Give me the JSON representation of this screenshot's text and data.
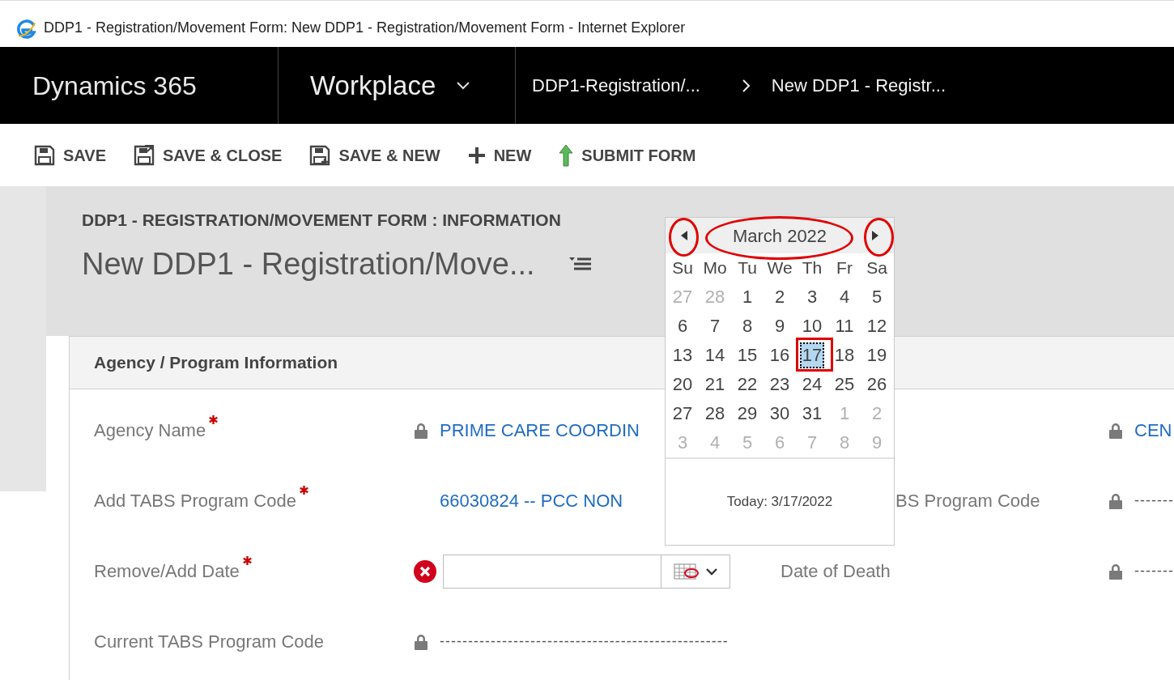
{
  "window": {
    "title": "DDP1 - Registration/Movement Form: New DDP1 - Registration/Movement Form - Internet Explorer"
  },
  "nav": {
    "app": "Dynamics 365",
    "area": "Workplace",
    "breadcrumbs": [
      "DDP1-Registration/...",
      "New DDP1 - Registr..."
    ]
  },
  "commands": [
    {
      "label": "SAVE",
      "kind": "save"
    },
    {
      "label": "SAVE & CLOSE",
      "kind": "save-close"
    },
    {
      "label": "SAVE & NEW",
      "kind": "save-new"
    },
    {
      "label": "NEW",
      "kind": "new"
    },
    {
      "label": "SUBMIT FORM",
      "kind": "submit"
    }
  ],
  "header": {
    "entity": "DDP1 - REGISTRATION/MOVEMENT FORM : INFORMATION",
    "title": "New DDP1 - Registration/Move..."
  },
  "section": {
    "title": "Agency / Program Information",
    "rows": [
      {
        "label": "Agency Name",
        "required": true,
        "value": {
          "kind": "locked-link",
          "text": "PRIME CARE COORDIN"
        },
        "right": {
          "value": {
            "kind": "locked-link",
            "text": "CEN"
          }
        }
      },
      {
        "label": "Add TABS Program Code",
        "required": true,
        "value": {
          "kind": "link",
          "text": "66030824 -- PCC NON"
        },
        "right": {
          "label": "BS Program Code",
          "value": {
            "kind": "locked",
            "text": "-------"
          }
        }
      },
      {
        "label": "Remove/Add Date",
        "required": true,
        "value": {
          "kind": "date",
          "error": true
        },
        "right": {
          "label": "Date of Death",
          "value": {
            "kind": "locked",
            "text": "-------"
          }
        }
      },
      {
        "label": "Current TABS Program Code",
        "required": false,
        "value": {
          "kind": "locked",
          "text": "---------------------------------------------------"
        }
      }
    ]
  },
  "calendar": {
    "month": "March 2022",
    "weekdays": [
      "Su",
      "Mo",
      "Tu",
      "We",
      "Th",
      "Fr",
      "Sa"
    ],
    "weeks": [
      [
        {
          "day": "27",
          "muted": true,
          "selected": false
        },
        {
          "day": "28",
          "muted": true,
          "selected": false
        },
        {
          "day": "1",
          "muted": false,
          "selected": false
        },
        {
          "day": "2",
          "muted": false,
          "selected": false
        },
        {
          "day": "3",
          "muted": false,
          "selected": false
        },
        {
          "day": "4",
          "muted": false,
          "selected": false
        },
        {
          "day": "5",
          "muted": false,
          "selected": false
        }
      ],
      [
        {
          "day": "6",
          "muted": false,
          "selected": false
        },
        {
          "day": "7",
          "muted": false,
          "selected": false
        },
        {
          "day": "8",
          "muted": false,
          "selected": false
        },
        {
          "day": "9",
          "muted": false,
          "selected": false
        },
        {
          "day": "10",
          "muted": false,
          "selected": false
        },
        {
          "day": "11",
          "muted": false,
          "selected": false
        },
        {
          "day": "12",
          "muted": false,
          "selected": false
        }
      ],
      [
        {
          "day": "13",
          "muted": false,
          "selected": false
        },
        {
          "day": "14",
          "muted": false,
          "selected": false
        },
        {
          "day": "15",
          "muted": false,
          "selected": false
        },
        {
          "day": "16",
          "muted": false,
          "selected": false
        },
        {
          "day": "17",
          "muted": false,
          "selected": true
        },
        {
          "day": "18",
          "muted": false,
          "selected": false
        },
        {
          "day": "19",
          "muted": false,
          "selected": false
        }
      ],
      [
        {
          "day": "20",
          "muted": false,
          "selected": false
        },
        {
          "day": "21",
          "muted": false,
          "selected": false
        },
        {
          "day": "22",
          "muted": false,
          "selected": false
        },
        {
          "day": "23",
          "muted": false,
          "selected": false
        },
        {
          "day": "24",
          "muted": false,
          "selected": false
        },
        {
          "day": "25",
          "muted": false,
          "selected": false
        },
        {
          "day": "26",
          "muted": false,
          "selected": false
        }
      ],
      [
        {
          "day": "27",
          "muted": false,
          "selected": false
        },
        {
          "day": "28",
          "muted": false,
          "selected": false
        },
        {
          "day": "29",
          "muted": false,
          "selected": false
        },
        {
          "day": "30",
          "muted": false,
          "selected": false
        },
        {
          "day": "31",
          "muted": false,
          "selected": false
        },
        {
          "day": "1",
          "muted": true,
          "selected": false
        },
        {
          "day": "2",
          "muted": true,
          "selected": false
        }
      ],
      [
        {
          "day": "3",
          "muted": true,
          "selected": false
        },
        {
          "day": "4",
          "muted": true,
          "selected": false
        },
        {
          "day": "5",
          "muted": true,
          "selected": false
        },
        {
          "day": "6",
          "muted": true,
          "selected": false
        },
        {
          "day": "7",
          "muted": true,
          "selected": false
        },
        {
          "day": "8",
          "muted": true,
          "selected": false
        },
        {
          "day": "9",
          "muted": true,
          "selected": false
        }
      ]
    ],
    "today": "Today: 3/17/2022"
  }
}
